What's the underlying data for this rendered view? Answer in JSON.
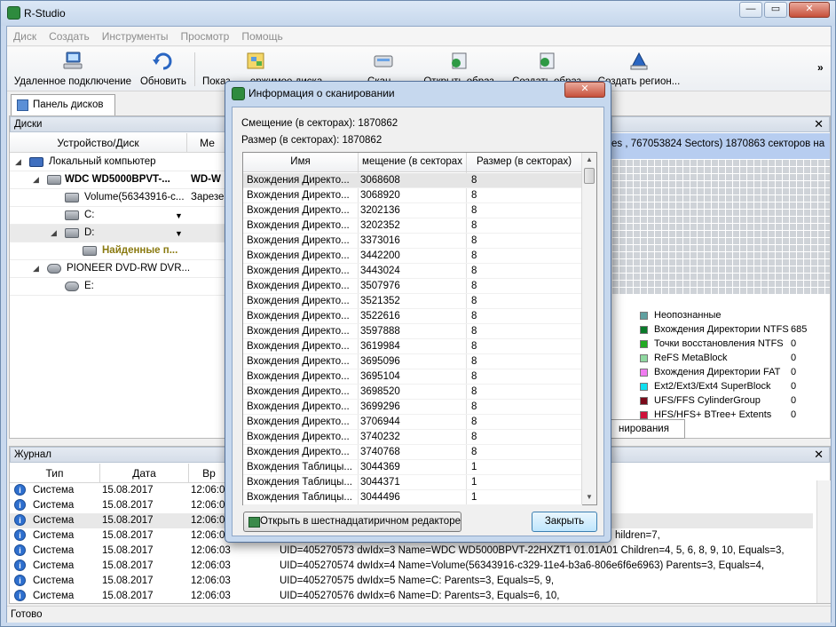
{
  "window": {
    "title": "R-Studio",
    "minimize": "—",
    "restore": "▭",
    "close": "✕"
  },
  "menu": [
    "Диск",
    "Создать",
    "Инструменты",
    "Просмотр",
    "Помощь"
  ],
  "toolbar": {
    "remote": "Удаленное подключение",
    "refresh": "Обновить",
    "show": "Показ... ...ержимое диска",
    "scan": "Скан...",
    "open_image": "Открыть образ",
    "save_image": "Создать образ",
    "create_region": "Создать регион...",
    "more": "»"
  },
  "tab": {
    "label": "Панель дисков"
  },
  "disks_pane": {
    "title": "Диски",
    "close": "✕",
    "col_device": "Устройство/Диск",
    "col_label": "Ме",
    "rows": [
      {
        "name": "Локальный компьютер",
        "label": ""
      },
      {
        "name": "WDC WD5000BPVT-...",
        "label": "WD-W"
      },
      {
        "name": "Volume(56343916-c...",
        "label": "Зарезер"
      },
      {
        "name": "C:",
        "label": ""
      },
      {
        "name": "D:",
        "label": ""
      },
      {
        "name": "Найденные п...",
        "label": ""
      },
      {
        "name": "PIONEER DVD-RW DVR...",
        "label": ""
      },
      {
        "name": "E:",
        "label": ""
      }
    ]
  },
  "right_pane": {
    "close": "✕",
    "info": "es  , 767053824 Sectors) 1870863 секторов на",
    "legend": [
      {
        "name": "Неопознанные",
        "value": "",
        "color": "#5fa0a0"
      },
      {
        "name": "Вхождения Директории NTFS",
        "value": "685",
        "color": "#0a7a2a"
      },
      {
        "name": "Точки восстановления NTFS",
        "value": "0",
        "color": "#22aa22"
      },
      {
        "name": "ReFS MetaBlock",
        "value": "0",
        "color": "#8fd8a0"
      },
      {
        "name": "Вхождения Директории FAT",
        "value": "0",
        "color": "#f07cf0"
      },
      {
        "name": "Ext2/Ext3/Ext4 SuperBlock",
        "value": "0",
        "color": "#10e0f0"
      },
      {
        "name": "UFS/FFS CylinderGroup",
        "value": "0",
        "color": "#7a0a1a"
      },
      {
        "name": "HFS/HFS+ BTree+ Extents",
        "value": "0",
        "color": "#d0103a"
      }
    ],
    "stray": "3",
    "tab_label": "нирования"
  },
  "journal": {
    "title": "Журнал",
    "close": "✕",
    "cols": [
      "Тип",
      "Дата",
      "Вр"
    ],
    "rows": [
      {
        "type": "Система",
        "date": "15.08.2017",
        "time": "12:06:03",
        "msg": ""
      },
      {
        "type": "Система",
        "date": "15.08.2017",
        "time": "12:06:03",
        "msg": ""
      },
      {
        "type": "Система",
        "date": "15.08.2017",
        "time": "12:06:03",
        "msg": ""
      },
      {
        "type": "Система",
        "date": "15.08.2017",
        "time": "12:06:03",
        "msg": "hildren=7,"
      },
      {
        "type": "Система",
        "date": "15.08.2017",
        "time": "12:06:03",
        "msg": "UID=405270573 dwIdx=3 Name=WDC WD5000BPVT-22HXZT1 01.01A01  Children=4, 5, 6, 8, 9, 10,   Equals=3,"
      },
      {
        "type": "Система",
        "date": "15.08.2017",
        "time": "12:06:03",
        "msg": "UID=405270574 dwIdx=4 Name=Volume(56343916-c329-11e4-b3a6-806e6f6e6963)  Parents=3,   Equals=4,"
      },
      {
        "type": "Система",
        "date": "15.08.2017",
        "time": "12:06:03",
        "msg": "UID=405270575 dwIdx=5 Name=C:  Parents=3,   Equals=5, 9,"
      },
      {
        "type": "Система",
        "date": "15.08.2017",
        "time": "12:06:03",
        "msg": "UID=405270576 dwIdx=6 Name=D:  Parents=3,   Equals=6, 10,"
      }
    ]
  },
  "status": "Готово",
  "dialog": {
    "title": "Информация о сканировании",
    "close": "✕",
    "offset_label": "Смещение (в секторах): 1870862",
    "size_label": "Размер (в секторах): 1870862",
    "cols": [
      "Имя",
      "мещение (в секторах",
      "Размер (в секторах)"
    ],
    "rows": [
      [
        "Вхождения Директо...",
        "3068608",
        "8"
      ],
      [
        "Вхождения Директо...",
        "3068920",
        "8"
      ],
      [
        "Вхождения Директо...",
        "3202136",
        "8"
      ],
      [
        "Вхождения Директо...",
        "3202352",
        "8"
      ],
      [
        "Вхождения Директо...",
        "3373016",
        "8"
      ],
      [
        "Вхождения Директо...",
        "3442200",
        "8"
      ],
      [
        "Вхождения Директо...",
        "3443024",
        "8"
      ],
      [
        "Вхождения Директо...",
        "3507976",
        "8"
      ],
      [
        "Вхождения Директо...",
        "3521352",
        "8"
      ],
      [
        "Вхождения Директо...",
        "3522616",
        "8"
      ],
      [
        "Вхождения Директо...",
        "3597888",
        "8"
      ],
      [
        "Вхождения Директо...",
        "3619984",
        "8"
      ],
      [
        "Вхождения Директо...",
        "3695096",
        "8"
      ],
      [
        "Вхождения Директо...",
        "3695104",
        "8"
      ],
      [
        "Вхождения Директо...",
        "3698520",
        "8"
      ],
      [
        "Вхождения Директо...",
        "3699296",
        "8"
      ],
      [
        "Вхождения Директо...",
        "3706944",
        "8"
      ],
      [
        "Вхождения Директо...",
        "3740232",
        "8"
      ],
      [
        "Вхождения Директо...",
        "3740768",
        "8"
      ],
      [
        "Вхождения Таблицы...",
        "3044369",
        "1"
      ],
      [
        "Вхождения Таблицы...",
        "3044371",
        "1"
      ],
      [
        "Вхождения Таблицы...",
        "3044496",
        "1"
      ]
    ],
    "hex_button": "Открыть в шестнадцатиричном редакторе",
    "close_button": "Закрыть"
  }
}
